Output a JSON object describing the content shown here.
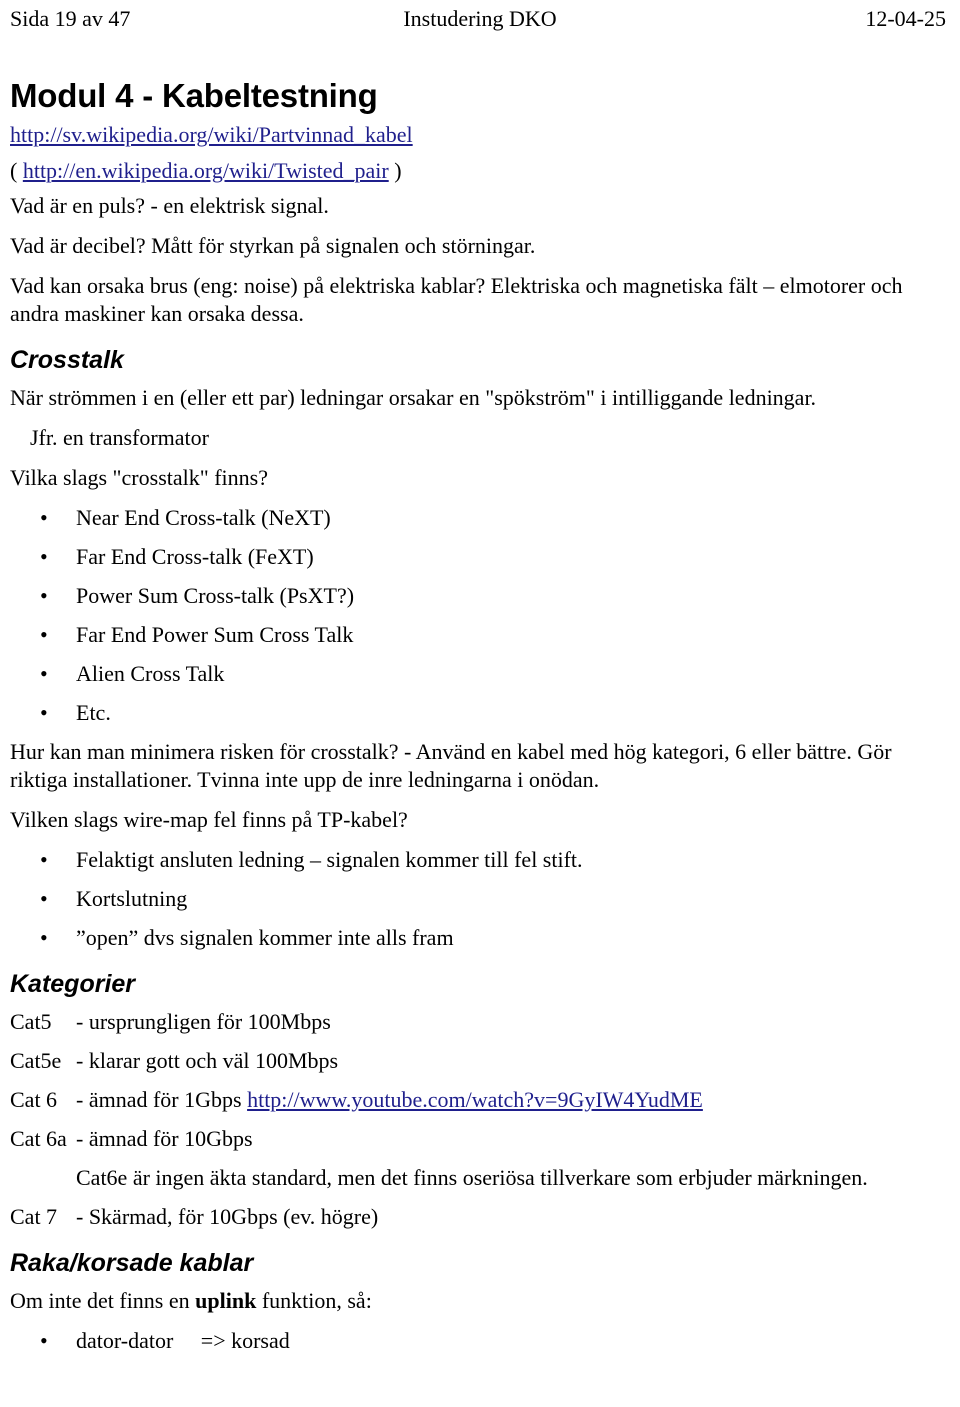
{
  "header": {
    "page_label": "Sida 19 av 47",
    "doc_title": "Instudering DKO",
    "date": "12-04-25"
  },
  "document": {
    "title": "Modul 4 - Kabeltestning",
    "links": {
      "wiki_sv": "http://sv.wikipedia.org/wiki/Partvinnad_kabel",
      "wiki_en_open": "( ",
      "wiki_en": "http://en.wikipedia.org/wiki/Twisted_pair",
      "wiki_en_close": " )"
    },
    "intro": [
      "Vad är en puls? - en elektrisk signal.",
      "Vad är decibel? Mått för styrkan på signalen och störningar.",
      "Vad kan orsaka brus (eng: noise) på elektriska kablar? Elektriska och magnetiska fält – elmotorer och andra maskiner kan orsaka dessa."
    ],
    "crosstalk": {
      "heading": "Crosstalk",
      "definition": "När strömmen i en (eller ett par) ledningar orsakar en \"spökström\" i intilliggande ledningar.",
      "note": "Jfr. en transformator",
      "question": "Vilka slags \"crosstalk\" finns?",
      "types": [
        "Near End Cross-talk (NeXT)",
        "Far End Cross-talk (FeXT)",
        "Power Sum Cross-talk (PsXT?)",
        "Far End Power Sum Cross Talk",
        "Alien Cross Talk",
        "Etc."
      ],
      "minimize": "Hur kan man minimera risken för crosstalk? - Använd en kabel med hög kategori, 6 eller bättre. Gör riktiga installationer. Tvinna inte upp de inre ledningarna i onödan."
    },
    "wiremap": {
      "question": "Vilken slags wire-map fel finns på TP-kabel?",
      "faults": [
        "Felaktigt ansluten ledning – signalen kommer till fel stift.",
        "Kortslutning",
        "”open” dvs signalen kommer inte alls fram"
      ]
    },
    "kategorier": {
      "heading": "Kategorier",
      "rows": [
        {
          "label": "Cat5",
          "desc": "- ursprungligen för 100Mbps",
          "link": ""
        },
        {
          "label": "Cat5e",
          "desc": "- klarar gott och väl 100Mbps",
          "link": ""
        },
        {
          "label": "Cat 6",
          "desc": "- ämnad för 1Gbps ",
          "link": "http://www.youtube.com/watch?v=9GyIW4YudME"
        },
        {
          "label": "Cat 6a",
          "desc": "- ämnad för 10Gbps",
          "link": ""
        }
      ],
      "cat6e_note": "Cat6e är ingen äkta standard, men det finns oseriösa tillverkare som erbjuder märkningen.",
      "cat7": {
        "label": "Cat 7",
        "desc": "- Skärmad, för 10Gbps (ev. högre)"
      }
    },
    "raka": {
      "heading": "Raka/korsade kablar",
      "lead_before": "Om inte det finns en ",
      "lead_bold": "uplink",
      "lead_after": " funktion, så:",
      "items": [
        "dator-dator     => korsad"
      ]
    }
  },
  "glyphs": {
    "bullet": "•"
  },
  "colors": {
    "text": "#000000",
    "link": "#1f1f8c",
    "background": "#ffffff"
  }
}
